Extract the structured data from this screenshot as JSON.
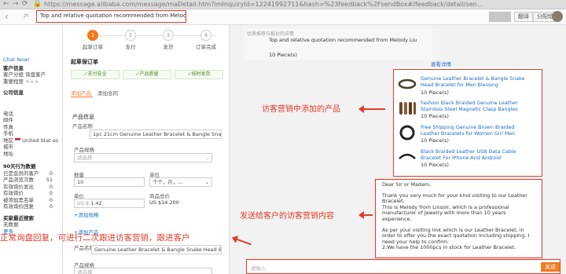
{
  "browser": {
    "url": "https://message.alibaba.com/message/maDetail.htm?imInquiryId=12241992711&hash=%23feedback%2FsendBox#/feedback/detail/sen...",
    "translate_label": "翻译",
    "share_label": "分配给"
  },
  "header": {
    "title": "Top and relative quotation recommended from Melody Liu",
    "prefix": "产"
  },
  "sidebar": {
    "chat_now": "Chat Now!",
    "customer_info_heading": "客户信息",
    "customer_group": "客户分组  询盘客户",
    "importance": "重要程度",
    "stars": "★★★",
    "company_heading": "公司信息",
    "phone": "电话",
    "email": "邮件",
    "fax": "传真",
    "mobile": "手机",
    "region": "地区",
    "region_value": "United Stat es",
    "city": "城市",
    "address": "地址",
    "behavior_heading": "90天行为数据",
    "stats": [
      {
        "label": "已是会员的客户",
        "value": "0"
      },
      {
        "label": "产品浏览次数",
        "value": "51"
      },
      {
        "label": "有效询价发出",
        "value": "0"
      },
      {
        "label": "有效询价",
        "value": "0"
      },
      {
        "label": "被添加黑名单",
        "value": "0"
      },
      {
        "label": "有效询价回复",
        "value": "0"
      }
    ],
    "buy_heading": "买家最近搜索",
    "no_data": "无数据",
    "more": "更多"
  },
  "steps": [
    {
      "num": "1",
      "label": "起草订单"
    },
    {
      "num": "2",
      "label": "支付"
    },
    {
      "num": "3",
      "label": "发货"
    },
    {
      "num": "4",
      "label": "订单完成"
    }
  ],
  "form": {
    "section_title": "起草保订单",
    "badges": [
      "✓支付安全",
      "✓产品质量",
      "✓按时发货"
    ],
    "tab_product": "添加产品",
    "tab_contract": "添加合同",
    "product_info": "产品信息",
    "product_name_label": "产品名称",
    "product_name_value": "1pc 21cm Genuine Leather Bracelet & Bangle Snake Head",
    "spec_label": "产品规格",
    "spec_placeholder": "请选择",
    "qty_label": "数量",
    "qty_value": "10",
    "unit_label": "单位",
    "unit_value": "个个，片，...",
    "price_label": "单价",
    "price_currency": "US $",
    "price_value": "1.42",
    "total_label": "商品总价",
    "total_value": "US $14.200",
    "add_spec": "+添加规格",
    "add_product": "+添加产品",
    "second_product_label": "产品名称",
    "second_product_value": "Genuine Leather Bracelet & Bangle Snake Head Bracelet f",
    "second_spec_label": "产品规格",
    "second_spec_placeholder": "请选择"
  },
  "chat": {
    "card_title_cn": "优质推荐与报价的详情",
    "card_title": "Top and relative quotation recommended from Melody Liu",
    "card_qty": "10 Piece(s)",
    "view_details": "查看详情",
    "products": [
      {
        "name": "Genuine Leather Bracelet & Bangle Snake Head Bracelet for Men Blessing",
        "qty": "10 Piece(s)"
      },
      {
        "name": "Fashion Black Braided Genuine Leather Stainless Steel Magnetic Clasp Bangles",
        "qty": "10 Piece(s)"
      },
      {
        "name": "Free Shipping Genuine Brown Braided Leather Bracelets for Women Girl Men",
        "qty": "10 Piece(s)"
      },
      {
        "name": "Black Braided Leather USB Data Cable Bracelet For iPhone And Android",
        "qty": "10 Piece(s)"
      }
    ],
    "message": [
      "Dear Sir or Madam,",
      "Thank you very much for your kind visiting to our Leather Bracelet.\nThis is Melody from Linsoir, which is a professional manufacturer of Jewelry with more than 10 years experience.",
      "As per your visiting link which is our Leather Bracelet, in order to offer you the exact quotation including shipping, I need your help to confirm:\n2.We have the 1000pcs in stock for Leather Bracelet."
    ],
    "input_placeholder": "请输入",
    "send_label": "发送"
  },
  "annotations": {
    "products_added": "访客营销中添加的产品",
    "marketing_content": "发送给客户的访客营销内容",
    "bottom_note": "正常询盘回复，可进行二次跟进访客营销，跟进客户"
  },
  "colors": {
    "annotation_red": "#e23b2a",
    "accent_orange": "#f47a20",
    "link_blue": "#1a6fc4"
  }
}
